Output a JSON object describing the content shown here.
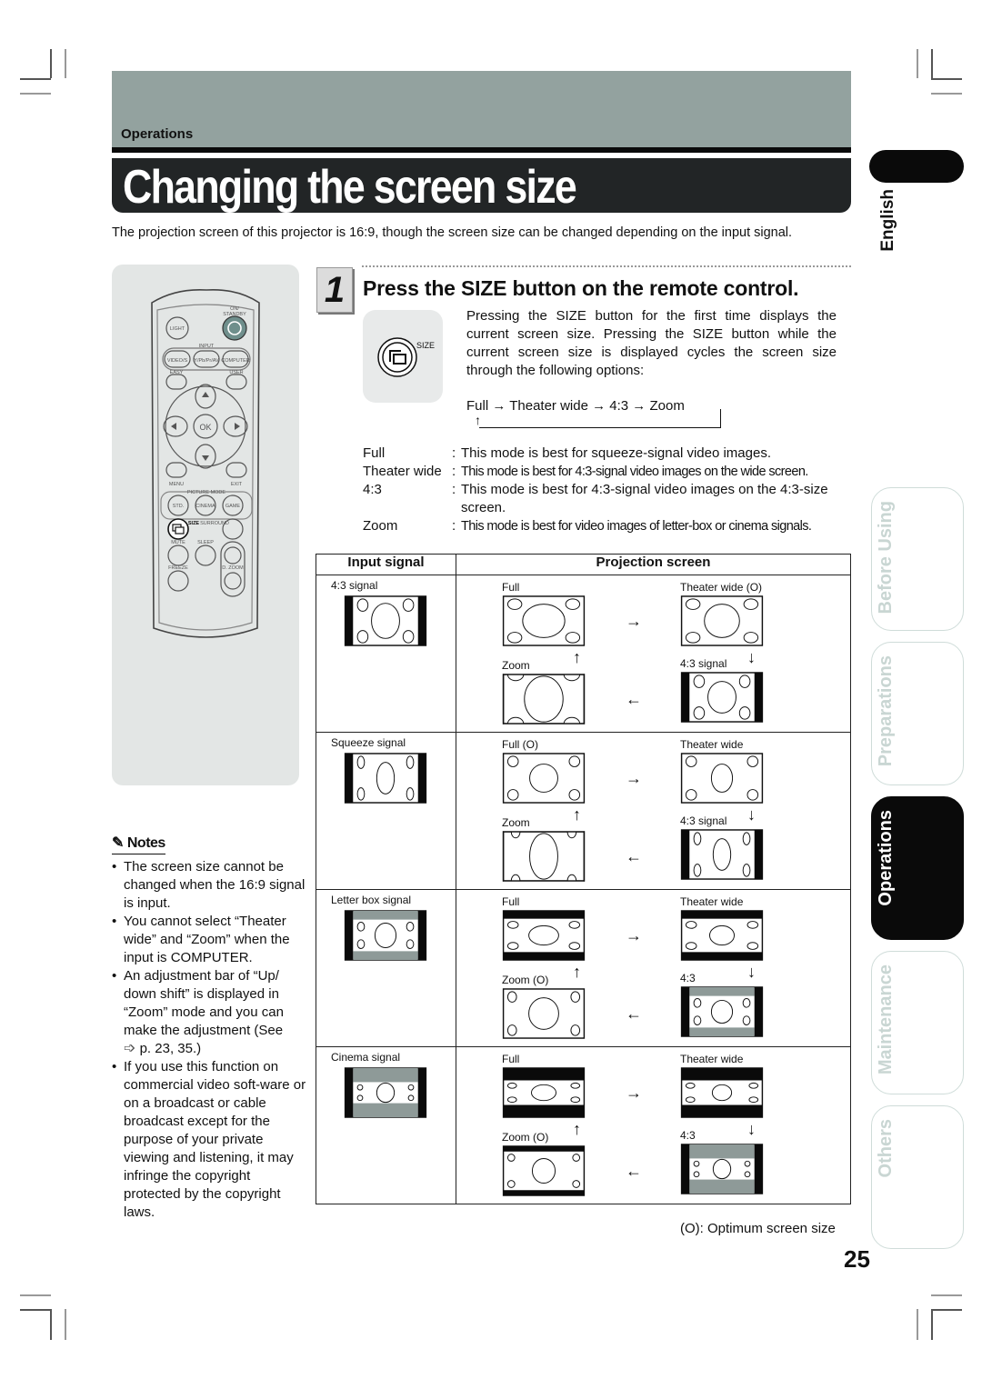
{
  "header": {
    "section": "Operations",
    "title": "Changing the screen size",
    "intro": "The projection screen of this projector is 16:9, though the screen size can be changed depending on the input signal."
  },
  "side_tabs": {
    "language": "English",
    "items": [
      {
        "label": "Before Using",
        "active": false
      },
      {
        "label": "Preparations",
        "active": false
      },
      {
        "label": "Operations",
        "active": true
      },
      {
        "label": "Maintenance",
        "active": false
      },
      {
        "label": "Others",
        "active": false
      }
    ]
  },
  "remote": {
    "labels": {
      "on_standby": "ON/ STANDBY",
      "light": "LIGHT",
      "input": "INPUT",
      "video_s": "VIDEO/S",
      "ypbpr": "Y/Pb/Pr/AV",
      "computer": "COMPUTER",
      "easy": "EASY",
      "user": "USER",
      "ok": "OK",
      "menu": "MENU",
      "exit": "EXIT",
      "picture_mode": "PICTURE MODE",
      "std": "STD.",
      "cinema": "CINEMA",
      "game": "GAME",
      "size": "SIZE",
      "surround": "SURROUND",
      "mute": "MUTE",
      "sleep": "SLEEP",
      "freeze": "FREEZE",
      "d_zoom": "D. ZOOM"
    },
    "accent_color": "#6f8f8c"
  },
  "notes": {
    "heading": "Notes",
    "items": [
      "The screen size cannot be changed when the 16:9 signal is input.",
      "You cannot select “Theater wide” and “Zoom” when the input is COMPUTER.",
      "An adjustment bar of “Up/ down shift” is displayed in “Zoom” mode and you can make the adjustment (See",
      "If you use this function on commercial video soft-ware or on a broadcast or cable broadcast except for the purpose of your private viewing and listening, it may infringe the copyright protected by the copyright laws."
    ],
    "ref": "p. 23, 35.)"
  },
  "step": {
    "number": "1",
    "title": "Press the SIZE button on the remote control.",
    "button_label": "SIZE",
    "description": "Pressing the SIZE button for the first time displays the current screen size. Pressing the SIZE button while the current screen size is displayed cycles the screen size through the following options:",
    "cycle": "Full → Theater wide → 4:3 → Zoom",
    "modes": [
      {
        "name": "Full",
        "desc": "This mode is best for squeeze-signal video images."
      },
      {
        "name": "Theater wide",
        "desc": "This mode is best for 4:3-signal video images on the wide screen."
      },
      {
        "name": "4:3",
        "desc": "This mode is best for 4:3-signal video images on the 4:3-size screen."
      },
      {
        "name": "Zoom",
        "desc": "This mode is best for video images of letter-box or cinema signals."
      }
    ]
  },
  "table": {
    "headers": [
      "Input signal",
      "Projection screen"
    ],
    "rows": [
      {
        "input": "4:3 signal",
        "full": "Full",
        "theater": "Theater wide (O)",
        "zoom": "Zoom",
        "fourthree": "4:3 signal",
        "kind": "43"
      },
      {
        "input": "Squeeze signal",
        "full": "Full (O)",
        "theater": "Theater wide",
        "zoom": "Zoom",
        "fourthree": "4:3 signal",
        "kind": "squeeze"
      },
      {
        "input": "Letter box signal",
        "full": "Full",
        "theater": "Theater wide",
        "zoom": "Zoom (O)",
        "fourthree": "4:3",
        "kind": "letterbox"
      },
      {
        "input": "Cinema signal",
        "full": "Full",
        "theater": "Theater wide",
        "zoom": "Zoom (O)",
        "fourthree": "4:3",
        "kind": "cinema"
      }
    ],
    "arrows": {
      "right": "→",
      "down": "↓",
      "left": "←",
      "up": "↑"
    },
    "footnote": "(O): Optimum screen size"
  },
  "page_number": "25",
  "colors": {
    "band": "#93a29f",
    "title_bg": "#222526",
    "matte_gray": "#8e9a98"
  }
}
